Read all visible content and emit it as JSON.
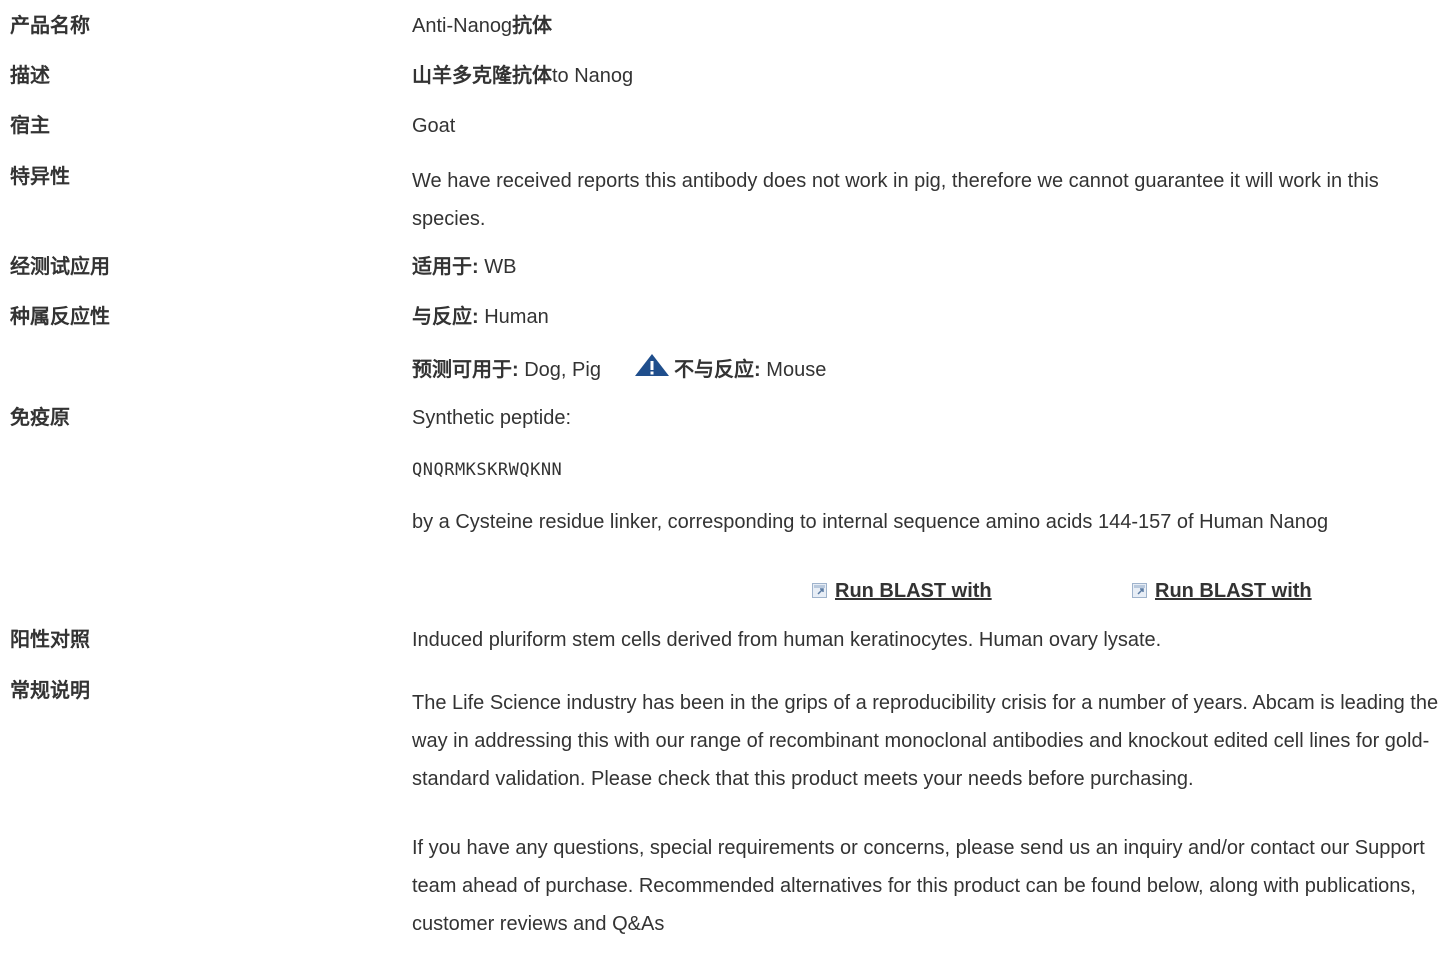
{
  "rows": {
    "product_name": {
      "label": "产品名称",
      "prefix": "Anti-Nanog",
      "suffix": "抗体"
    },
    "description": {
      "label": "描述",
      "prefix": "山羊多克隆抗体",
      "suffix": "to Nanog"
    },
    "host": {
      "label": "宿主",
      "value": "Goat"
    },
    "specificity": {
      "label": "特异性",
      "value": "We have received reports this antibody does not work in pig, therefore we cannot guarantee it will work in this species."
    },
    "tested_applications": {
      "label": "经测试应用",
      "key": "适用于:",
      "value": " WB"
    },
    "species_reactivity": {
      "label": "种属反应性",
      "reacts_key": "与反应:",
      "reacts_value": " Human",
      "predicted_key": "预测可用于:",
      "predicted_value": " Dog, Pig",
      "not_reacts_key": "不与反应:",
      "not_reacts_value": " Mouse"
    },
    "immunogen": {
      "label": "免疫原",
      "line1": "Synthetic peptide:",
      "sequence": "QNQRMKSKRWQKNN",
      "line3": "by a Cysteine residue linker, corresponding to internal sequence amino acids 144-157 of Human Nanog",
      "blast_link_1": "Run BLAST with",
      "blast_link_2": "Run BLAST with"
    },
    "positive_control": {
      "label": "阳性对照",
      "value": "Induced pluriform stem cells derived from human keratinocytes. Human ovary lysate."
    },
    "general_notes": {
      "label": "常规说明",
      "paragraph1": "The Life Science industry has been in the grips of a reproducibility crisis for a number of years. Abcam is leading the way in addressing this with our range of recombinant monoclonal antibodies and knockout edited cell lines for gold-standard validation. Please check that this product meets your needs before purchasing.",
      "paragraph2": "If you have any questions, special requirements or concerns, please send us an inquiry and/or contact our Support team ahead of purchase. Recommended alternatives for this product can be found below, along with publications, customer reviews and Q&As"
    }
  },
  "icons": {
    "warning": "warning-triangle-icon",
    "external": "external-link-icon"
  },
  "colors": {
    "text": "#333333",
    "warning_blue": "#1f4e8c"
  }
}
